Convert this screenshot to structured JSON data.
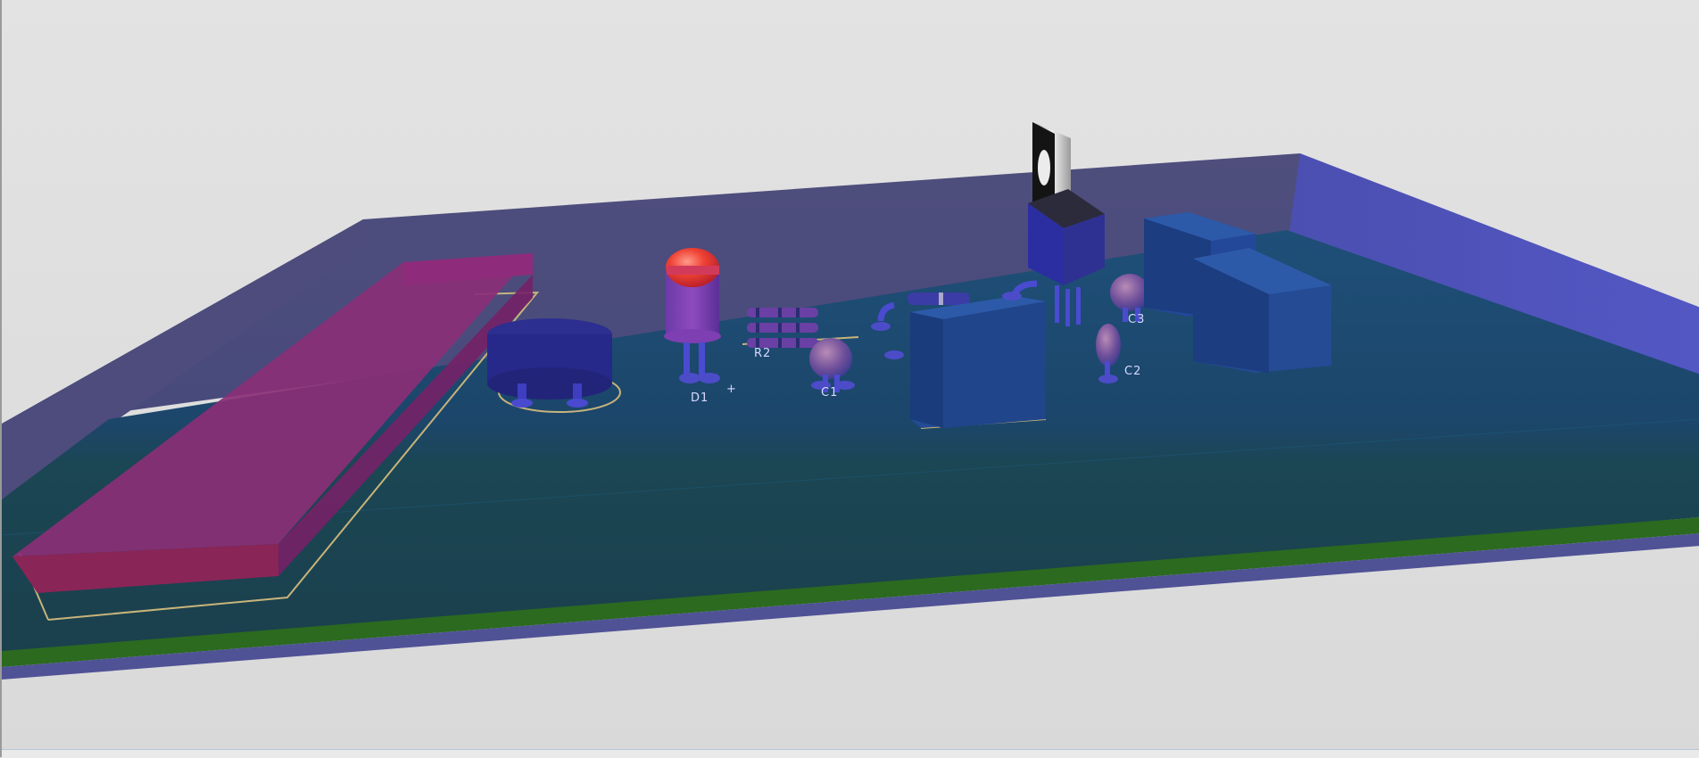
{
  "viewer": {
    "background_color": "#dcdcdc",
    "board_color": "#1d4a66",
    "board_edge_color": "#2a6b1f",
    "enclosure_color": "#4a4ea8"
  },
  "silkscreen": {
    "d1_label": "D1",
    "c1_label": "C1",
    "r2_label": "R2",
    "c2_label": "C2",
    "c3_label": "C3",
    "polarity_plus": "+"
  }
}
